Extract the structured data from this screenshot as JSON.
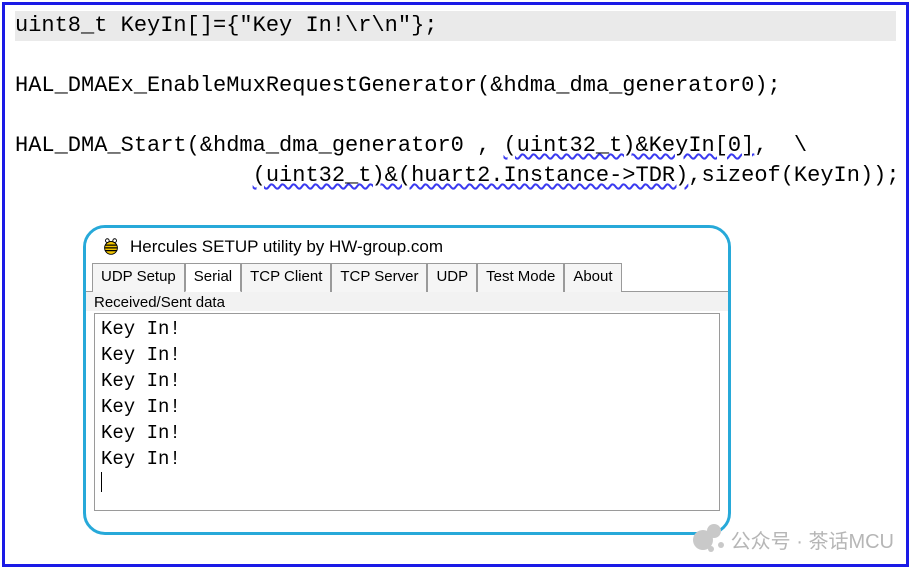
{
  "code": {
    "line1": "uint8_t KeyIn[]={\"Key In!\\r\\n\"};",
    "line2": "",
    "line3": "HAL_DMAEx_EnableMuxRequestGenerator(&hdma_dma_generator0);",
    "line4": "",
    "line5_prefix": "HAL_DMA_Start(&hdma_dma_generator0 , ",
    "line5_wavy": "(uint32_t)&KeyIn[0]",
    "line5_suffix": ",  \\",
    "line6_indent": "                  ",
    "line6_wavy": "(uint32_t)&(huart2.Instance->TDR)",
    "line6_suffix": ",sizeof(KeyIn));"
  },
  "hercules": {
    "title": "Hercules SETUP utility by HW-group.com",
    "tabs": [
      {
        "label": "UDP Setup",
        "active": false
      },
      {
        "label": "Serial",
        "active": true
      },
      {
        "label": "TCP Client",
        "active": false
      },
      {
        "label": "TCP Server",
        "active": false
      },
      {
        "label": "UDP",
        "active": false
      },
      {
        "label": "Test Mode",
        "active": false
      },
      {
        "label": "About",
        "active": false
      }
    ],
    "group_label": "Received/Sent data",
    "terminal_lines": [
      "Key In!",
      "Key In!",
      "Key In!",
      "Key In!",
      "Key In!",
      "Key In!"
    ]
  },
  "watermark": "公众号 · 茶话MCU"
}
